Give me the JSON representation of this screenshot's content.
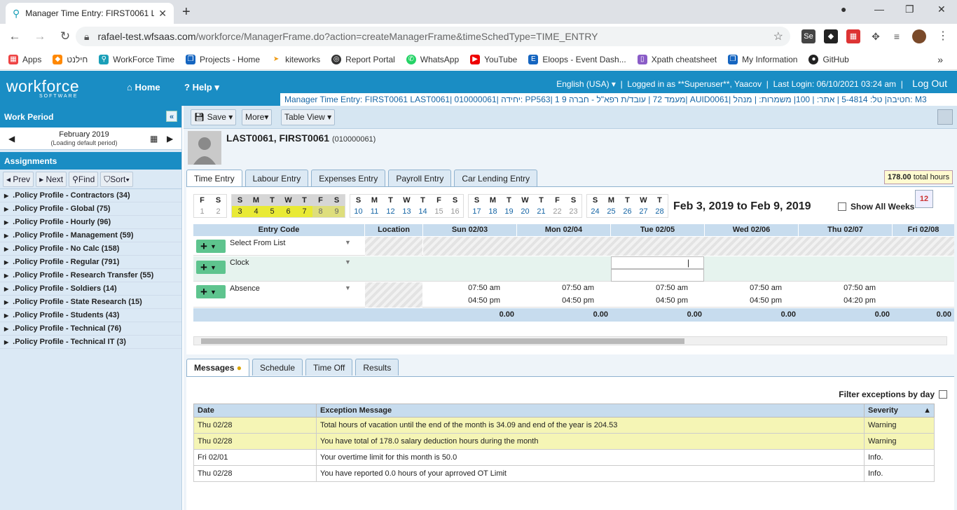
{
  "browser": {
    "tab_title": "Manager Time Entry: FIRST0061 L",
    "url_host": "rafael-test.wfsaas.com",
    "url_path": "/workforce/ManagerFrame.do?action=createManagerFrame&timeSchedType=TIME_ENTRY",
    "bookmarks": [
      "Apps",
      "חילנט",
      "WorkForce Time",
      "Projects - Home",
      "kiteworks",
      "Report Portal",
      "WhatsApp",
      "YouTube",
      "Eloops - Event Dash...",
      "Xpath cheatsheet",
      "My Information",
      "GitHub"
    ]
  },
  "header": {
    "logo": "workforce",
    "logo_sub": "SOFTWARE",
    "home": "Home",
    "help": "Help",
    "language": "English (USA)",
    "logged_in": "Logged in as **Superuser**, Yaacov",
    "last_login": "Last Login: 06/10/2021 03:24 am",
    "logout": "Log Out",
    "info_line": "Manager Time Entry: FIRST0061 LAST0061| 010000061| יחידה: PP563| 1 מעמד 72 | עובד/ת רפא\"ל - חברה 9| AUID0061| חטיבה| טל: 5-4814 | אתר: | 100| משמרות: | מנהל: M3"
  },
  "left": {
    "work_period": "Work Period",
    "month": "February 2019",
    "loading": "(Loading default period)",
    "assignments": "Assignments",
    "prev": "Prev",
    "next": "Next",
    "find": "Find",
    "sort": "Sort",
    "profiles": [
      ".Policy Profile - Contractors (34)",
      ".Policy Profile - Global (75)",
      ".Policy Profile - Hourly (96)",
      ".Policy Profile - Management (59)",
      ".Policy Profile - No Calc (158)",
      ".Policy Profile - Regular (791)",
      ".Policy Profile - Research Transfer (55)",
      ".Policy Profile - Soldiers (14)",
      ".Policy Profile - State Research (15)",
      ".Policy Profile - Students (43)",
      ".Policy Profile - Technical (76)",
      ".Policy Profile - Technical IT (3)"
    ]
  },
  "toolbar": {
    "save": "Save",
    "more": "More",
    "view": "Table View"
  },
  "employee": {
    "name": "LAST0061, FIRST0061",
    "id": "(010000061)"
  },
  "tabs": [
    "Time Entry",
    "Labour Entry",
    "Expenses Entry",
    "Payroll Entry",
    "Car Lending Entry"
  ],
  "calendar": {
    "range": "Feb 3, 2019 to Feb 9, 2019",
    "show_all_weeks": "Show All Weeks",
    "total_hours_value": "178.00",
    "total_hours_label": "total hours",
    "cal_icon_day": "12",
    "week0": {
      "letters": [
        "F",
        "S"
      ],
      "days": [
        "1",
        "2"
      ]
    },
    "weeks": [
      {
        "letters": [
          "S",
          "M",
          "T",
          "W",
          "T",
          "F",
          "S"
        ],
        "days": [
          "3",
          "4",
          "5",
          "6",
          "7",
          "8",
          "9"
        ]
      },
      {
        "letters": [
          "S",
          "M",
          "T",
          "W",
          "T",
          "F",
          "S"
        ],
        "days": [
          "10",
          "11",
          "12",
          "13",
          "14",
          "15",
          "16"
        ]
      },
      {
        "letters": [
          "S",
          "M",
          "T",
          "W",
          "T",
          "F",
          "S"
        ],
        "days": [
          "17",
          "18",
          "19",
          "20",
          "21",
          "22",
          "23"
        ]
      },
      {
        "letters": [
          "S",
          "M",
          "T",
          "W",
          "T"
        ],
        "days": [
          "24",
          "25",
          "26",
          "27",
          "28"
        ]
      }
    ]
  },
  "grid": {
    "headers": [
      "Entry Code",
      "Location",
      "Sun 02/03",
      "Mon 02/04",
      "Tue 02/05",
      "Wed 02/06",
      "Thu 02/07",
      "Fri 02/08"
    ],
    "rows": [
      {
        "code": "Select From List"
      },
      {
        "code": "Clock"
      },
      {
        "code": "Absence",
        "in": [
          "07:50 am",
          "07:50 am",
          "07:50 am",
          "07:50 am",
          "07:50 am"
        ],
        "out": [
          "04:50 pm",
          "04:50 pm",
          "04:50 pm",
          "04:50 pm",
          "04:20 pm"
        ]
      }
    ],
    "totals": [
      "0.00",
      "0.00",
      "0.00",
      "0.00",
      "0.00",
      "0.00"
    ]
  },
  "bottom_tabs": [
    "Messages",
    "Schedule",
    "Time Off",
    "Results"
  ],
  "messages": {
    "filter": "Filter exceptions by day",
    "headers": [
      "Date",
      "Exception Message",
      "Severity"
    ],
    "rows": [
      {
        "date": "Thu 02/28",
        "msg": "Total hours of vacation until the end of the month is 34.09 and end of the year is 204.53",
        "sev": "Warning"
      },
      {
        "date": "Thu 02/28",
        "msg": "You have total of 178.0 salary deduction hours during the month",
        "sev": "Warning"
      },
      {
        "date": "Fri 02/01",
        "msg": "Your overtime limit for this month is 50.0",
        "sev": "Info."
      },
      {
        "date": "Thu 02/28",
        "msg": "You have reported 0.0 hours of your aprroved OT Limit",
        "sev": "Info."
      }
    ]
  }
}
